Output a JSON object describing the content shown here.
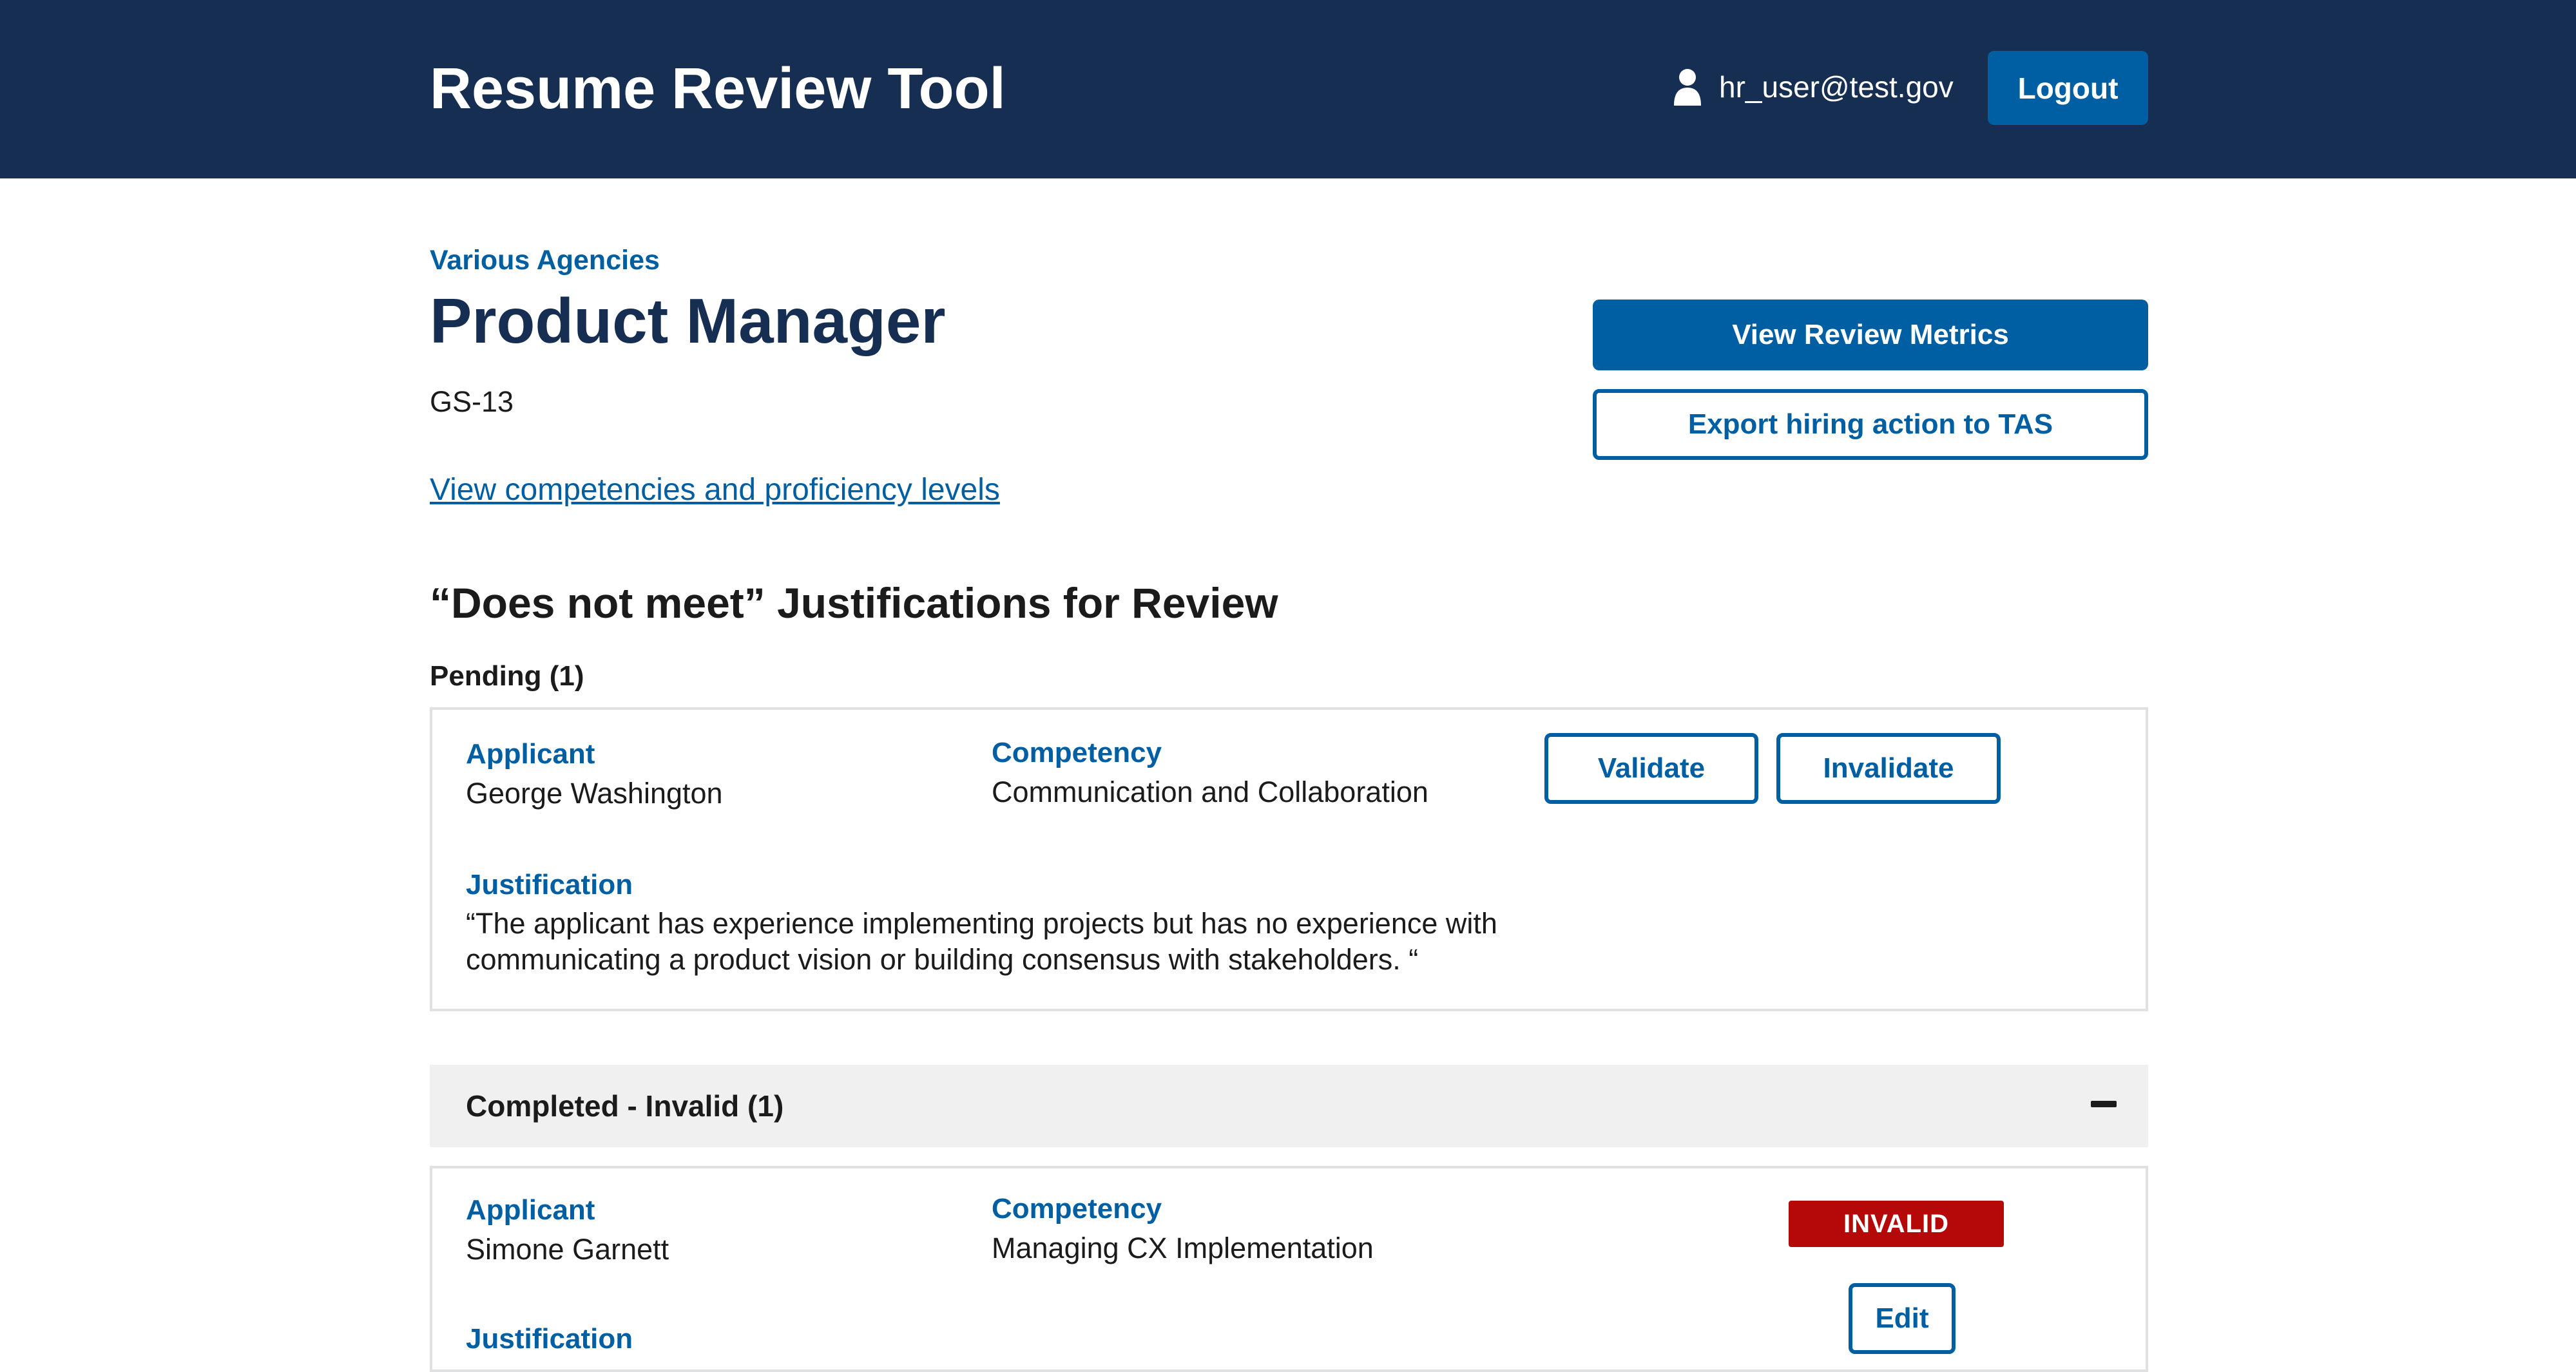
{
  "header": {
    "app_title": "Resume Review Tool",
    "user_email": "hr_user@test.gov",
    "logout_label": "Logout"
  },
  "job": {
    "agency": "Various Agencies",
    "title": "Product Manager",
    "grade": "GS-13",
    "competencies_link": "View competencies and proficiency levels"
  },
  "actions": {
    "view_metrics_label": "View Review Metrics",
    "export_label": "Export hiring action to TAS"
  },
  "review": {
    "heading": "“Does not meet” Justifications for Review",
    "pending_label": "Pending (1)",
    "pending_items": [
      {
        "applicant_label": "Applicant",
        "applicant": "George Washington",
        "competency_label": "Competency",
        "competency": "Communication and Collaboration",
        "justification_label": "Justification",
        "justification": "“The applicant has experience implementing projects but has no experience with communicating a product vision or building consensus with stakeholders. “",
        "validate_label": "Validate",
        "invalidate_label": "Invalidate"
      }
    ],
    "completed_invalid_label": "Completed - Invalid (1)",
    "completed_items": [
      {
        "applicant_label": "Applicant",
        "applicant": "Simone Garnett",
        "competency_label": "Competency",
        "competency": "Managing CX Implementation",
        "justification_label": "Justification",
        "status": "INVALID",
        "edit_label": "Edit"
      }
    ]
  },
  "colors": {
    "header_bg": "#162e51",
    "primary": "#005ea2",
    "invalid": "#b50909",
    "accordion_bg": "#f0f0f0"
  }
}
